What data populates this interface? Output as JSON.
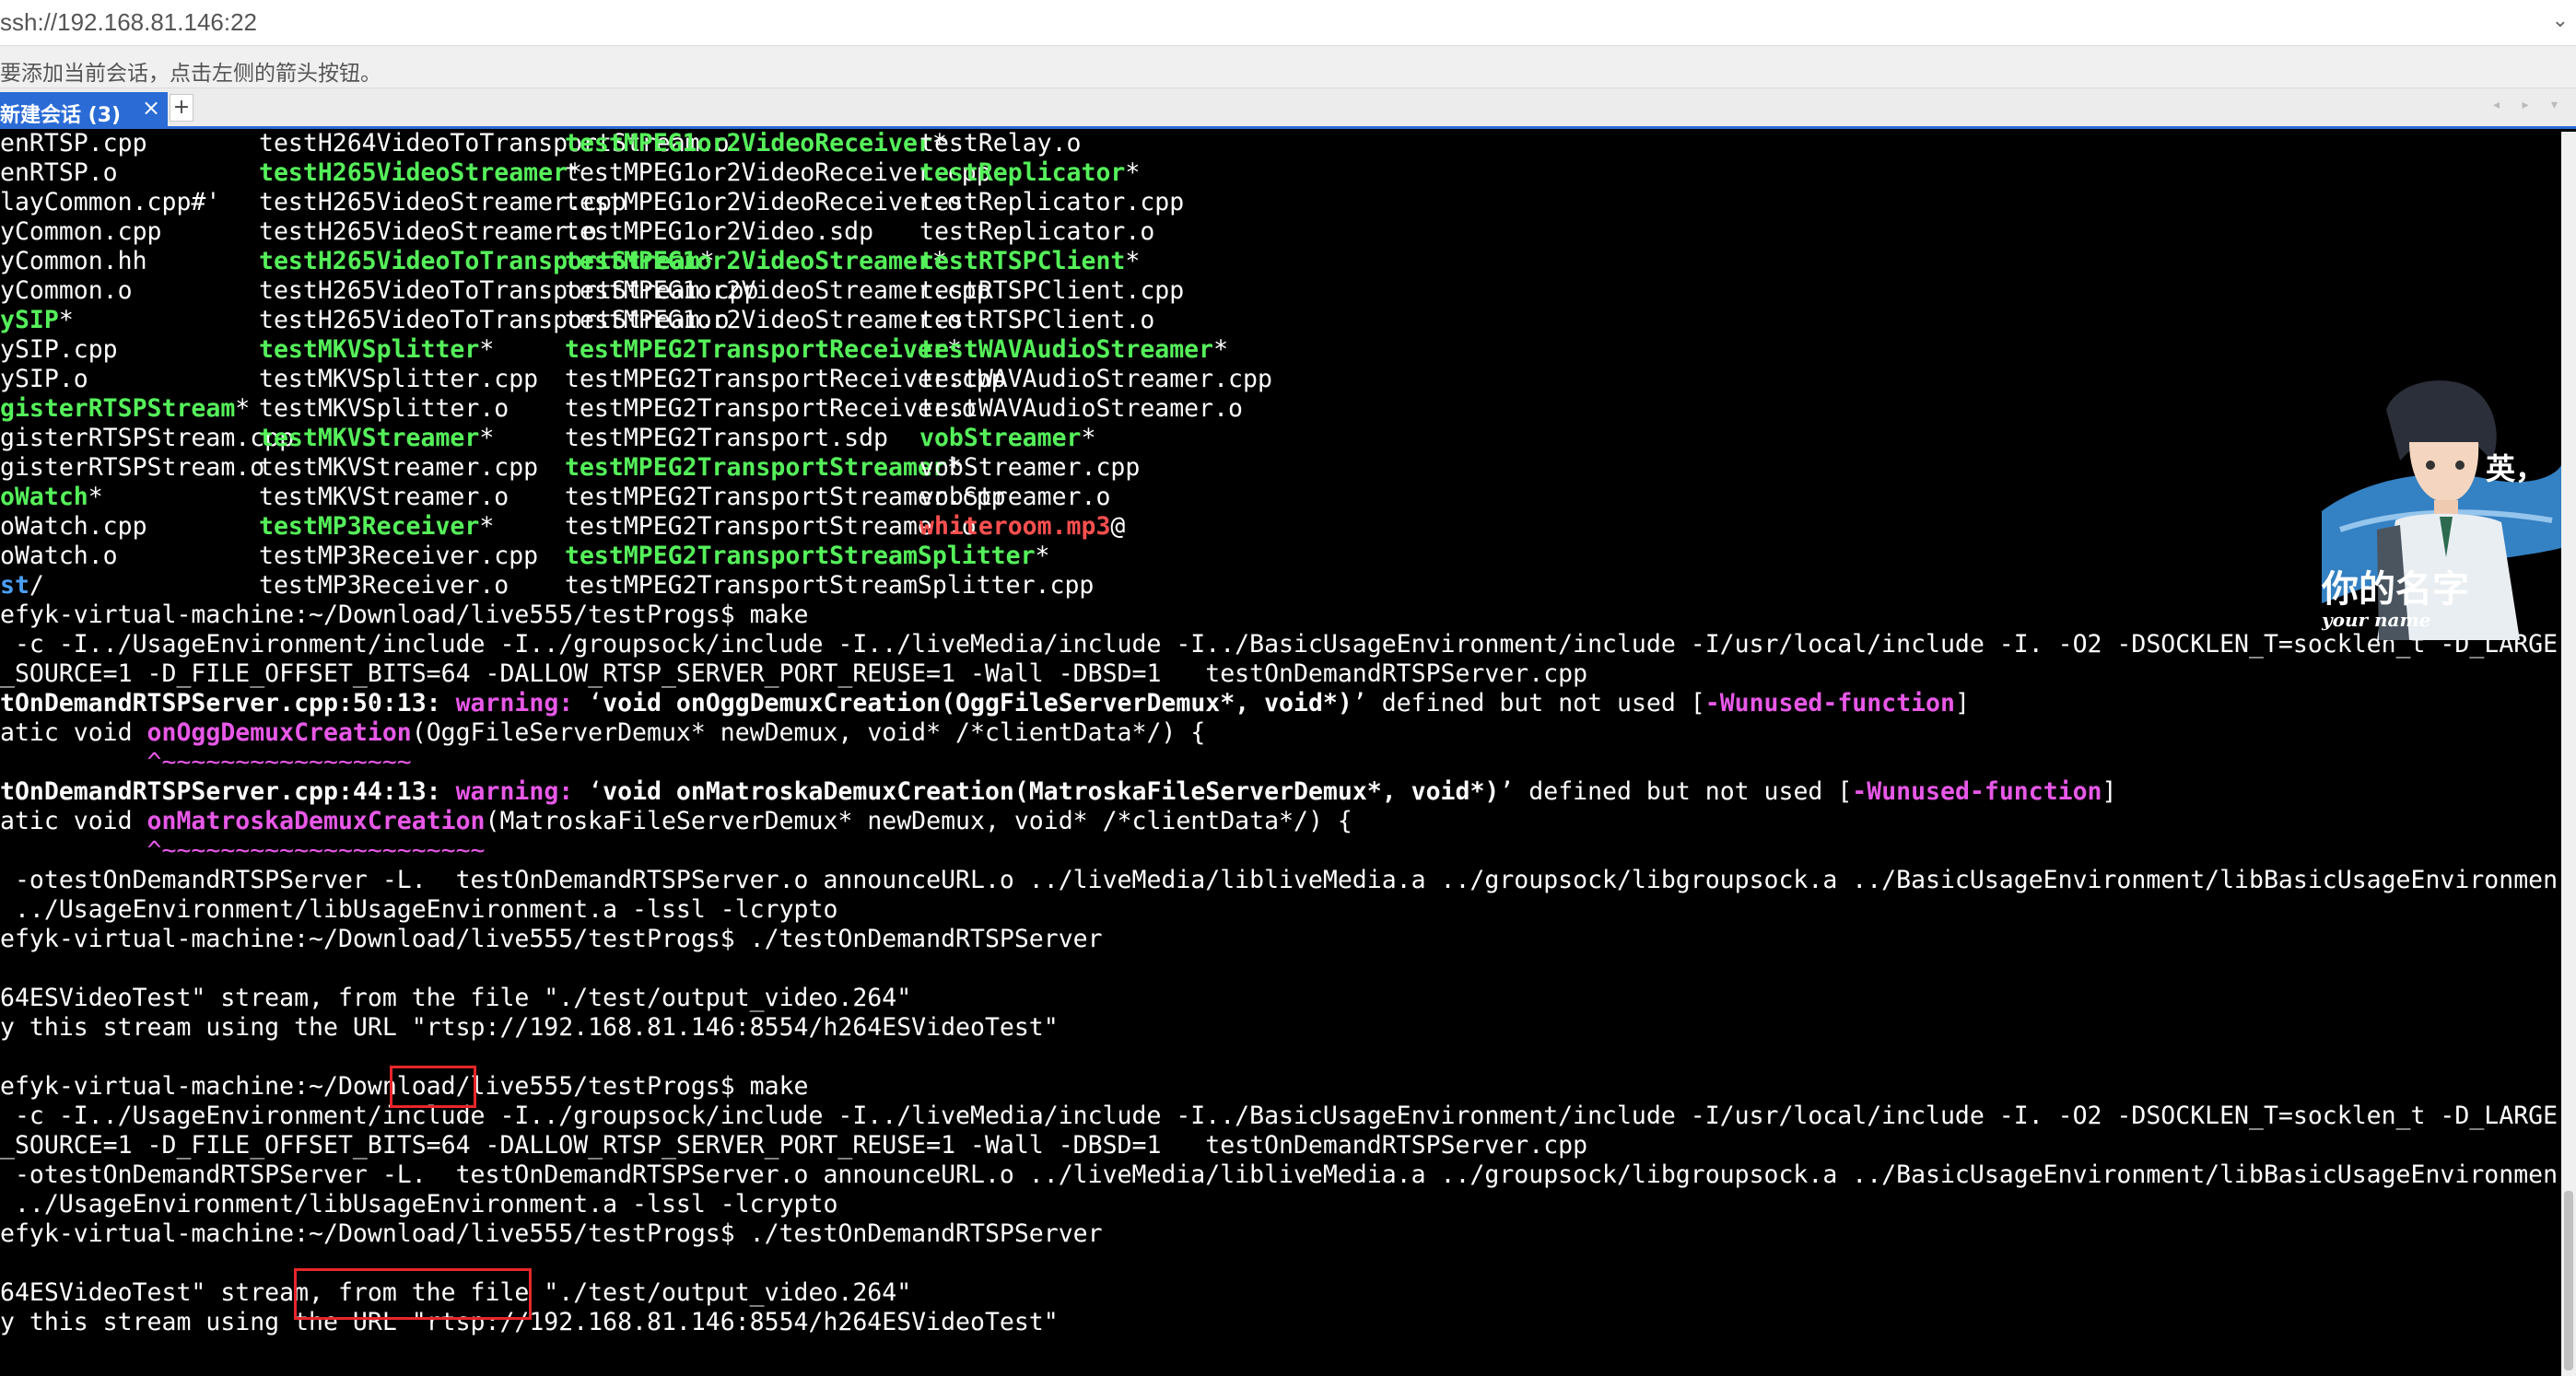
{
  "address_bar": {
    "url": "ssh://192.168.81.146:22"
  },
  "hint_bar": {
    "text": "要添加当前会话，点击左侧的箭头按钮。"
  },
  "tabs": {
    "active_label": "新建会话 (3)",
    "close_symbol": "×",
    "add_symbol": "+",
    "nav_symbols": "◂ ▸ ▾"
  },
  "terminal": {
    "columns": [
      [
        [
          {
            "t": "enRTSP.cpp",
            "c": ""
          }
        ],
        [
          {
            "t": "enRTSP.o",
            "c": ""
          }
        ],
        [
          {
            "t": "layCommon.cpp#'",
            "c": ""
          }
        ],
        [
          {
            "t": "yCommon.cpp",
            "c": ""
          }
        ],
        [
          {
            "t": "yCommon.hh",
            "c": ""
          }
        ],
        [
          {
            "t": "yCommon.o",
            "c": ""
          }
        ],
        [
          {
            "t": "ySIP",
            "c": "exe"
          },
          {
            "t": "*",
            "c": ""
          }
        ],
        [
          {
            "t": "ySIP.cpp",
            "c": ""
          }
        ],
        [
          {
            "t": "ySIP.o",
            "c": ""
          }
        ],
        [
          {
            "t": "gisterRTSPStream",
            "c": "exe"
          },
          {
            "t": "*",
            "c": ""
          }
        ],
        [
          {
            "t": "gisterRTSPStream.cpp",
            "c": ""
          }
        ],
        [
          {
            "t": "gisterRTSPStream.o",
            "c": ""
          }
        ],
        [
          {
            "t": "oWatch",
            "c": "exe"
          },
          {
            "t": "*",
            "c": ""
          }
        ],
        [
          {
            "t": "oWatch.cpp",
            "c": ""
          }
        ],
        [
          {
            "t": "oWatch.o",
            "c": ""
          }
        ],
        [
          {
            "t": "st",
            "c": "dir"
          },
          {
            "t": "/",
            "c": ""
          }
        ]
      ],
      [
        [
          {
            "t": "testH264VideoToTransportStream.o",
            "c": ""
          }
        ],
        [
          {
            "t": "testH265VideoStreamer",
            "c": "exe"
          },
          {
            "t": "*",
            "c": ""
          }
        ],
        [
          {
            "t": "testH265VideoStreamer.cpp",
            "c": ""
          }
        ],
        [
          {
            "t": "testH265VideoStreamer.o",
            "c": ""
          }
        ],
        [
          {
            "t": "testH265VideoToTransportStream",
            "c": "exe"
          },
          {
            "t": "*",
            "c": ""
          }
        ],
        [
          {
            "t": "testH265VideoToTransportStream.cpp",
            "c": ""
          }
        ],
        [
          {
            "t": "testH265VideoToTransportStream.o",
            "c": ""
          }
        ],
        [
          {
            "t": "testMKVSplitter",
            "c": "exe"
          },
          {
            "t": "*",
            "c": ""
          }
        ],
        [
          {
            "t": "testMKVSplitter.cpp",
            "c": ""
          }
        ],
        [
          {
            "t": "testMKVSplitter.o",
            "c": ""
          }
        ],
        [
          {
            "t": "testMKVStreamer",
            "c": "exe"
          },
          {
            "t": "*",
            "c": ""
          }
        ],
        [
          {
            "t": "testMKVStreamer.cpp",
            "c": ""
          }
        ],
        [
          {
            "t": "testMKVStreamer.o",
            "c": ""
          }
        ],
        [
          {
            "t": "testMP3Receiver",
            "c": "exe"
          },
          {
            "t": "*",
            "c": ""
          }
        ],
        [
          {
            "t": "testMP3Receiver.cpp",
            "c": ""
          }
        ],
        [
          {
            "t": "testMP3Receiver.o",
            "c": ""
          }
        ]
      ],
      [
        [
          {
            "t": "testMPEG1or2VideoReceiver",
            "c": "exe"
          },
          {
            "t": "*",
            "c": ""
          }
        ],
        [
          {
            "t": "testMPEG1or2VideoReceiver.cpp",
            "c": ""
          }
        ],
        [
          {
            "t": "testMPEG1or2VideoReceiver.o",
            "c": ""
          }
        ],
        [
          {
            "t": "testMPEG1or2Video.sdp",
            "c": ""
          }
        ],
        [
          {
            "t": "testMPEG1or2VideoStreamer",
            "c": "exe"
          },
          {
            "t": "*",
            "c": ""
          }
        ],
        [
          {
            "t": "testMPEG1or2VideoStreamer.cpp",
            "c": ""
          }
        ],
        [
          {
            "t": "testMPEG1or2VideoStreamer.o",
            "c": ""
          }
        ],
        [
          {
            "t": "testMPEG2TransportReceiver",
            "c": "exe"
          },
          {
            "t": "*",
            "c": ""
          }
        ],
        [
          {
            "t": "testMPEG2TransportReceiver.cpp",
            "c": ""
          }
        ],
        [
          {
            "t": "testMPEG2TransportReceiver.o",
            "c": ""
          }
        ],
        [
          {
            "t": "testMPEG2Transport.sdp",
            "c": ""
          }
        ],
        [
          {
            "t": "testMPEG2TransportStreamer",
            "c": "exe"
          },
          {
            "t": "*",
            "c": ""
          }
        ],
        [
          {
            "t": "testMPEG2TransportStreamer.cpp",
            "c": ""
          }
        ],
        [
          {
            "t": "testMPEG2TransportStreamer.o",
            "c": ""
          }
        ],
        [
          {
            "t": "testMPEG2TransportStreamSplitter",
            "c": "exe"
          },
          {
            "t": "*",
            "c": ""
          }
        ],
        [
          {
            "t": "testMPEG2TransportStreamSplitter.cpp",
            "c": ""
          }
        ]
      ],
      [
        [
          {
            "t": "testRelay.o",
            "c": ""
          }
        ],
        [
          {
            "t": "testReplicator",
            "c": "exe"
          },
          {
            "t": "*",
            "c": ""
          }
        ],
        [
          {
            "t": "testReplicator.cpp",
            "c": ""
          }
        ],
        [
          {
            "t": "testReplicator.o",
            "c": ""
          }
        ],
        [
          {
            "t": "testRTSPClient",
            "c": "exe"
          },
          {
            "t": "*",
            "c": ""
          }
        ],
        [
          {
            "t": "testRTSPClient.cpp",
            "c": ""
          }
        ],
        [
          {
            "t": "testRTSPClient.o",
            "c": ""
          }
        ],
        [
          {
            "t": "testWAVAudioStreamer",
            "c": "exe"
          },
          {
            "t": "*",
            "c": ""
          }
        ],
        [
          {
            "t": "testWAVAudioStreamer.cpp",
            "c": ""
          }
        ],
        [
          {
            "t": "testWAVAudioStreamer.o",
            "c": ""
          }
        ],
        [
          {
            "t": "vobStreamer",
            "c": "exe"
          },
          {
            "t": "*",
            "c": ""
          }
        ],
        [
          {
            "t": "vobStreamer.cpp",
            "c": ""
          }
        ],
        [
          {
            "t": "vobStreamer.o",
            "c": ""
          }
        ],
        [
          {
            "t": "whiteroom.mp3",
            "c": "link"
          },
          {
            "t": "@",
            "c": ""
          }
        ]
      ]
    ],
    "log": [
      [
        {
          "t": "efyk-virtual-machine:~/Download/live555/testProgs$ make",
          "c": ""
        }
      ],
      [
        {
          "t": " -c -I../UsageEnvironment/include -I../groupsock/include -I../liveMedia/include -I../BasicUsageEnvironment/include -I/usr/local/include -I. -O2 -DSOCKLEN_T=socklen_t -D_LARGE",
          "c": ""
        }
      ],
      [
        {
          "t": "_SOURCE=1 -D_FILE_OFFSET_BITS=64 -DALLOW_RTSP_SERVER_PORT_REUSE=1 -Wall -DBSD=1   testOnDemandRTSPServer.cpp",
          "c": ""
        }
      ],
      [
        {
          "t": "tOnDemandRTSPServer.cpp:50:13: ",
          "c": "bold"
        },
        {
          "t": "warning: ",
          "c": "warn"
        },
        {
          "t": "‘",
          "c": ""
        },
        {
          "t": "void onOggDemuxCreation(OggFileServerDemux*, void*)",
          "c": "bold"
        },
        {
          "t": "’ defined but not used [",
          "c": ""
        },
        {
          "t": "-Wunused-function",
          "c": "warn"
        },
        {
          "t": "]",
          "c": ""
        }
      ],
      [
        {
          "t": "atic void ",
          "c": ""
        },
        {
          "t": "onOggDemuxCreation",
          "c": "warn"
        },
        {
          "t": "(OggFileServerDemux* newDemux, void* /*clientData*/) {",
          "c": ""
        }
      ],
      [
        {
          "t": "          ^~~~~~~~~~~~~~~~~~",
          "c": "caret"
        }
      ],
      [
        {
          "t": "tOnDemandRTSPServer.cpp:44:13: ",
          "c": "bold"
        },
        {
          "t": "warning: ",
          "c": "warn"
        },
        {
          "t": "‘",
          "c": ""
        },
        {
          "t": "void onMatroskaDemuxCreation(MatroskaFileServerDemux*, void*)",
          "c": "bold"
        },
        {
          "t": "’ defined but not used [",
          "c": ""
        },
        {
          "t": "-Wunused-function",
          "c": "warn"
        },
        {
          "t": "]",
          "c": ""
        }
      ],
      [
        {
          "t": "atic void ",
          "c": ""
        },
        {
          "t": "onMatroskaDemuxCreation",
          "c": "warn"
        },
        {
          "t": "(MatroskaFileServerDemux* newDemux, void* /*clientData*/) {",
          "c": ""
        }
      ],
      [
        {
          "t": "          ^~~~~~~~~~~~~~~~~~~~~~~",
          "c": "caret"
        }
      ],
      [
        {
          "t": " -otestOnDemandRTSPServer -L.  testOnDemandRTSPServer.o announceURL.o ../liveMedia/libliveMedia.a ../groupsock/libgroupsock.a ../BasicUsageEnvironment/libBasicUsageEnvironmen",
          "c": ""
        }
      ],
      [
        {
          "t": " ../UsageEnvironment/libUsageEnvironment.a -lssl -lcrypto",
          "c": ""
        }
      ],
      [
        {
          "t": "efyk-virtual-machine:~/Download/live555/testProgs$ ./testOnDemandRTSPServer",
          "c": ""
        }
      ],
      [
        {
          "t": "",
          "c": ""
        }
      ],
      [
        {
          "t": "64ESVideoTest\" stream, from the file \"./test/output_video.264\"",
          "c": ""
        }
      ],
      [
        {
          "t": "y this stream using the URL \"rtsp://192.168.81.146:8554/h264ESVideoTest\"",
          "c": ""
        }
      ],
      [
        {
          "t": "",
          "c": ""
        }
      ],
      [
        {
          "t": "efyk-virtual-machine:~/Download/live555/testProgs$ make",
          "c": ""
        }
      ],
      [
        {
          "t": " -c -I../UsageEnvironment/include -I../groupsock/include -I../liveMedia/include -I../BasicUsageEnvironment/include -I/usr/local/include -I. -O2 -DSOCKLEN_T=socklen_t -D_LARGE",
          "c": ""
        }
      ],
      [
        {
          "t": "_SOURCE=1 -D_FILE_OFFSET_BITS=64 -DALLOW_RTSP_SERVER_PORT_REUSE=1 -Wall -DBSD=1   testOnDemandRTSPServer.cpp",
          "c": ""
        }
      ],
      [
        {
          "t": " -otestOnDemandRTSPServer -L.  testOnDemandRTSPServer.o announceURL.o ../liveMedia/libliveMedia.a ../groupsock/libgroupsock.a ../BasicUsageEnvironment/libBasicUsageEnvironmen",
          "c": ""
        }
      ],
      [
        {
          "t": " ../UsageEnvironment/libUsageEnvironment.a -lssl -lcrypto",
          "c": ""
        }
      ],
      [
        {
          "t": "efyk-virtual-machine:~/Download/live555/testProgs$ ./testOnDemandRTSPServer",
          "c": ""
        }
      ],
      [
        {
          "t": "",
          "c": ""
        }
      ],
      [
        {
          "t": "64ESVideoTest\" stream, from the file \"./test/output_video.264\"",
          "c": ""
        }
      ],
      [
        {
          "t": "y this stream using the URL \"rtsp://192.168.81.146:8554/h264ESVideoTest\"",
          "c": ""
        }
      ]
    ]
  },
  "avatar": {
    "caption_cn": "你的名字",
    "caption_top": "英，",
    "caption_en": "your name"
  },
  "colors": {
    "executable": "#55f05a",
    "symlink": "#ff4f4f",
    "directory": "#4b9ff5",
    "warning": "#e858e8",
    "annotation": "#e8262a",
    "tab_accent": "#2a6bd6"
  }
}
